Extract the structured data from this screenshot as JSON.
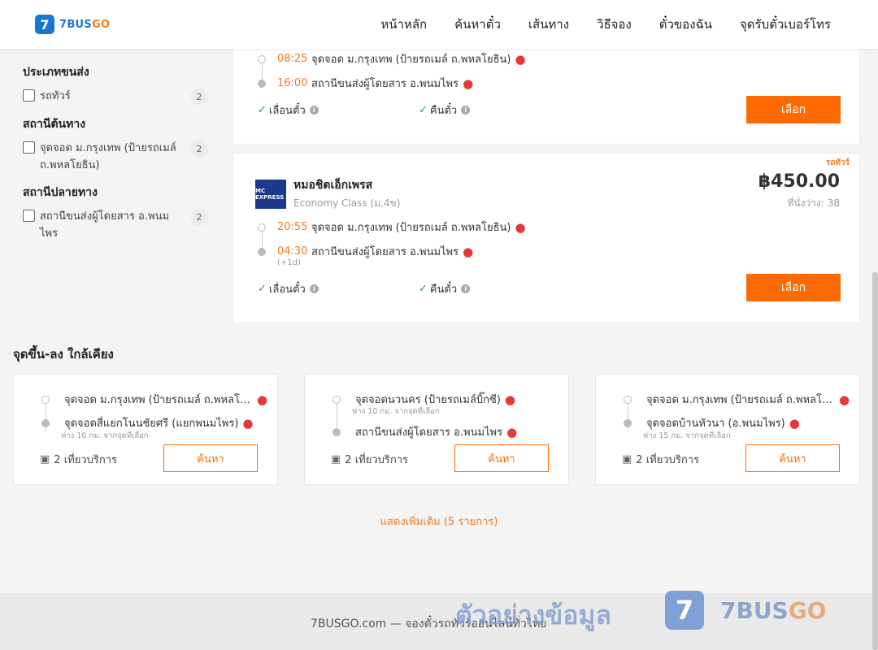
{
  "header": {
    "logo_digit": "7",
    "logo_text_main": "7BUS",
    "logo_text_accent": "GO",
    "nav": [
      "หน้าหลัก",
      "ค้นหาตั๋ว",
      "เส้นทาง",
      "วิธีจอง",
      "ตั๋วของฉัน",
      "จุดรับตั๋วเบอร์โทร"
    ]
  },
  "sidebar": {
    "groups": [
      {
        "title": "ประเภทขนส่ง",
        "items": [
          {
            "label": "รถทัวร์",
            "count": "2"
          }
        ]
      },
      {
        "title": "สถานีต้นทาง",
        "items": [
          {
            "label": "จุดจอด ม.กรุงเทพ (ป้ายรถเมล์ ถ.พหลโยธิน)",
            "count": "2"
          }
        ]
      },
      {
        "title": "สถานีปลายทาง",
        "items": [
          {
            "label": "สถานีขนส่งผู้โดยสาร อ.พนมไพร",
            "count": "2"
          }
        ]
      }
    ]
  },
  "results": [
    {
      "depart_time": "08:25",
      "depart_stop": "จุดจอด ม.กรุงเทพ (ป้ายรถเมล์ ถ.พหลโยธิน)",
      "arrive_time": "16:00",
      "arrive_stop": "สถานีขนส่งผู้โดยสาร อ.พนมไพร",
      "feature_1": "เลื่อนตั๋ว",
      "feature_2": "คืนตั๋ว",
      "select_label": "เลือก"
    },
    {
      "tag": "รถทัวร์",
      "operator": "หมอชิตเอ็กเพรส",
      "operator_logo": "MC EXPRESS",
      "bus_class": "Economy Class (ม.4ข)",
      "price": "฿450.00",
      "seats": "ที่นั่งว่าง: 38",
      "depart_time": "20:55",
      "depart_stop": "จุดจอด ม.กรุงเทพ (ป้ายรถเมล์ ถ.พหลโยธิน)",
      "arrive_time": "04:30",
      "arrive_stop": "สถานีขนส่งผู้โดยสาร อ.พนมไพร",
      "next_day": "(+1d)",
      "feature_1": "เลื่อนตั๋ว",
      "feature_2": "คืนตั๋ว",
      "select_label": "เลือก"
    }
  ],
  "nearby": {
    "title": "จุดขึ้น-ลง ใกล้เคียง",
    "cards": [
      {
        "from": "จุดจอด ม.กรุงเทพ (ป้ายรถเมล์ ถ.พหลโยธิน)",
        "from_dist": "",
        "to": "จุดจอดสี่แยกโนนชัยศรี (แยกพนมไพร)",
        "to_dist": "ห่าง 10 กม. จากจุดที่เลือก",
        "trips": "2 เที่ยวบริการ",
        "button": "ค้นหา"
      },
      {
        "from": "จุดจอดนวนคร (ป้ายรถเมล์บิ๊กซี)",
        "from_dist": "ห่าง 10 กม. จากจุดที่เลือก",
        "to": "สถานีขนส่งผู้โดยสาร อ.พนมไพร",
        "to_dist": "",
        "trips": "2 เที่ยวบริการ",
        "button": "ค้นหา"
      },
      {
        "from": "จุดจอด ม.กรุงเทพ (ป้ายรถเมล์ ถ.พหลโยธิน)",
        "from_dist": "",
        "to": "จุดจอดบ้านหัวนา (อ.พนมไพร)",
        "to_dist": "ห่าง 15 กม. จากจุดที่เลือก",
        "trips": "2 เที่ยวบริการ",
        "button": "ค้นหา"
      }
    ],
    "show_more": "แสดงเพิ่มเติม (5 รายการ)"
  },
  "footer": {
    "text": "7BUSGO.com — จองตั๋วรถทัวร์ออนไลน์ทั่วไทย"
  },
  "watermark": {
    "text": "ตัวอย่างข้อมูล",
    "logo_digit": "7",
    "logo_main": "7BUS",
    "logo_accent": "GO"
  }
}
